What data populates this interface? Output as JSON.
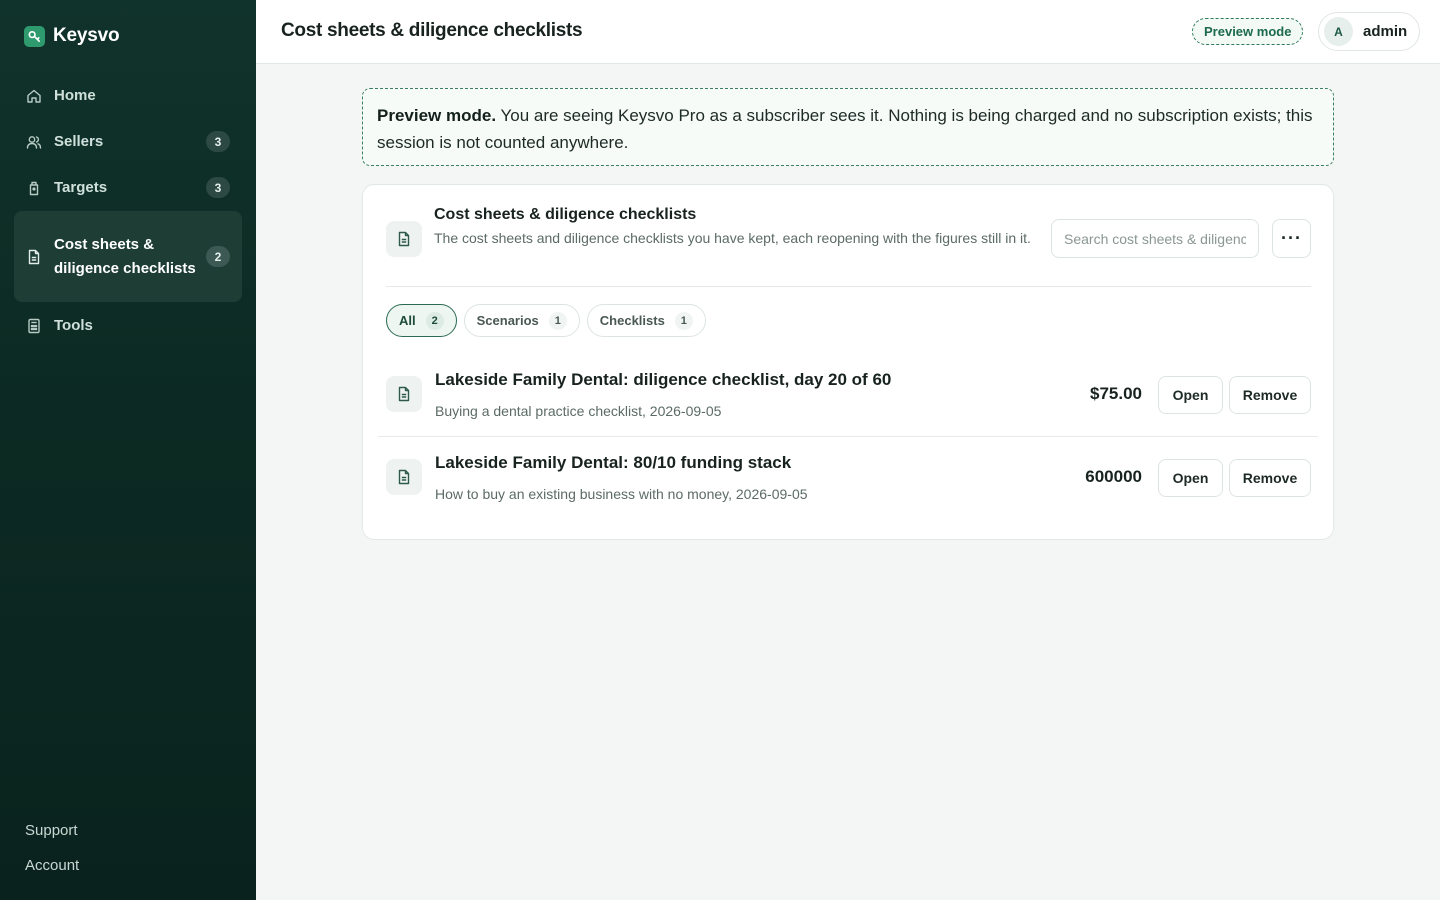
{
  "app": {
    "name": "Keysvo"
  },
  "sidebar": {
    "items": [
      {
        "label": "Home",
        "icon": "home-icon",
        "count": null
      },
      {
        "label": "Sellers",
        "icon": "users-icon",
        "count": "3"
      },
      {
        "label": "Targets",
        "icon": "target-icon",
        "count": "3"
      },
      {
        "label": "Cost sheets & diligence checklists",
        "icon": "document-icon",
        "count": "2",
        "active": true
      },
      {
        "label": "Tools",
        "icon": "calculator-icon",
        "count": null
      }
    ],
    "footer": {
      "support": "Support",
      "account": "Account"
    }
  },
  "header": {
    "title": "Cost sheets & diligence checklists",
    "preview_badge": "Preview mode",
    "user": {
      "initial": "A",
      "name": "admin"
    }
  },
  "notice": {
    "bold": "Preview mode.",
    "text": " You are seeing Keysvo Pro as a subscriber sees it. Nothing is being charged and no subscription exists; this session is not counted anywhere."
  },
  "panel": {
    "title": "Cost sheets & diligence checklists",
    "subtitle": "The cost sheets and diligence checklists you have kept, each reopening with the figures still in it.",
    "search_placeholder": "Search cost sheets & diligence checklists",
    "more_label": "···",
    "filters": [
      {
        "label": "All",
        "count": "2",
        "active": true
      },
      {
        "label": "Scenarios",
        "count": "1",
        "active": false
      },
      {
        "label": "Checklists",
        "count": "1",
        "active": false
      }
    ],
    "rows": [
      {
        "title": "Lakeside Family Dental: diligence checklist, day 20 of 60",
        "meta": "Buying a dental practice checklist, 2026-09-05",
        "amount": "$75.00",
        "open_label": "Open",
        "remove_label": "Remove"
      },
      {
        "title": "Lakeside Family Dental: 80/10 funding stack",
        "meta": "How to buy an existing business with no money, 2026-09-05",
        "amount": "600000",
        "open_label": "Open",
        "remove_label": "Remove"
      }
    ]
  },
  "colors": {
    "sidebar_bg": "#0c2a23",
    "accent": "#2e9a6e",
    "page_bg": "#f3f6f5"
  }
}
